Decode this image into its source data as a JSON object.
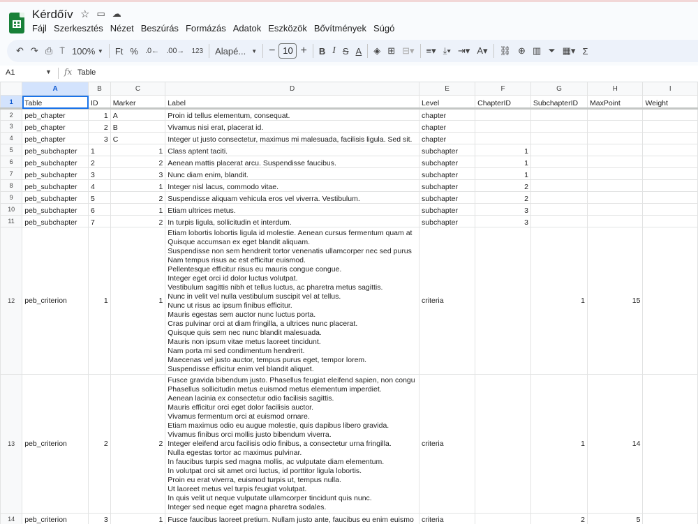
{
  "app": {
    "title": "Kérdőív"
  },
  "menu": [
    "Fájl",
    "Szerkesztés",
    "Nézet",
    "Beszúrás",
    "Formázás",
    "Adatok",
    "Eszközök",
    "Bővítmények",
    "Súgó"
  ],
  "toolbar": {
    "zoom": "100%",
    "currency": "Ft",
    "percent": "%",
    "dec_minus": ".0←",
    "dec_plus": ".00→",
    "number_format": "123",
    "font": "Alapé...",
    "font_size": "10"
  },
  "formula": {
    "cell": "A1",
    "fx": "fx",
    "value": "Table"
  },
  "columns": [
    "A",
    "B",
    "C",
    "D",
    "E",
    "F",
    "G",
    "H",
    "I"
  ],
  "rows": [
    {
      "n": "1",
      "cells": [
        "Table",
        "ID",
        "Marker",
        "Label",
        "Level",
        "ChapterID",
        "SubchapterID",
        "MaxPoint",
        "Weight"
      ]
    },
    {
      "n": "2",
      "cells": [
        "peb_chapter",
        "1",
        "A",
        "Proin id tellus elementum, consequat.",
        "chapter",
        "",
        "",
        "",
        ""
      ]
    },
    {
      "n": "3",
      "cells": [
        "peb_chapter",
        "2",
        "B",
        "Vivamus nisi erat, placerat id.",
        "chapter",
        "",
        "",
        "",
        ""
      ]
    },
    {
      "n": "4",
      "cells": [
        "peb_chapter",
        "3",
        "C",
        "Integer ut justo consectetur, maximus mi malesuada, facilisis ligula. Sed sit.",
        "chapter",
        "",
        "",
        "",
        ""
      ]
    },
    {
      "n": "5",
      "cells": [
        "peb_subchapter",
        "1",
        "1",
        "Class aptent taciti.",
        "subchapter",
        "1",
        "",
        "",
        ""
      ]
    },
    {
      "n": "6",
      "cells": [
        "peb_subchapter",
        "2",
        "2",
        "Aenean mattis placerat arcu. Suspendisse faucibus.",
        "subchapter",
        "1",
        "",
        "",
        ""
      ]
    },
    {
      "n": "7",
      "cells": [
        "peb_subchapter",
        "3",
        "3",
        "Nunc diam enim, blandit.",
        "subchapter",
        "1",
        "",
        "",
        ""
      ]
    },
    {
      "n": "8",
      "cells": [
        "peb_subchapter",
        "4",
        "1",
        "Integer nisl lacus, commodo vitae.",
        "subchapter",
        "2",
        "",
        "",
        ""
      ]
    },
    {
      "n": "9",
      "cells": [
        "peb_subchapter",
        "5",
        "2",
        "Suspendisse aliquam vehicula eros vel viverra. Vestibulum.",
        "subchapter",
        "2",
        "",
        "",
        ""
      ]
    },
    {
      "n": "10",
      "cells": [
        "peb_subchapter",
        "6",
        "1",
        "Etiam ultrices metus.",
        "subchapter",
        "3",
        "",
        "",
        ""
      ]
    },
    {
      "n": "11",
      "cells": [
        "peb_subchapter",
        "7",
        "2",
        "In turpis ligula, sollicitudin et interdum.",
        "subchapter",
        "3",
        "",
        "",
        ""
      ]
    },
    {
      "n": "12",
      "cells": [
        "peb_criterion",
        "1",
        "1",
        "Etiam lobortis lobortis ligula id molestie. Aenean cursus fermentum quam at\nQuisque accumsan ex eget blandit aliquam.\nSuspendisse non sem hendrerit tortor venenatis ullamcorper nec sed purus\nNam tempus risus ac est efficitur euismod.\nPellentesque efficitur risus eu mauris congue congue.\nInteger eget orci id dolor luctus volutpat.\nVestibulum sagittis nibh et tellus luctus, ac pharetra metus sagittis.\nNunc in velit vel nulla vestibulum suscipit vel at tellus.\nNunc ut risus ac ipsum finibus efficitur.\nMauris egestas sem auctor nunc luctus porta.\nCras pulvinar orci at diam fringilla, a ultrices nunc placerat.\nQuisque quis sem nec nunc blandit malesuada.\nMauris non ipsum vitae metus laoreet tincidunt.\nNam porta mi sed condimentum hendrerit.\nMaecenas vel justo auctor, tempus purus eget, tempor lorem.\nSuspendisse efficitur enim vel blandit aliquet.",
        "criteria",
        "",
        "1",
        "15",
        ""
      ]
    },
    {
      "n": "13",
      "cells": [
        "peb_criterion",
        "2",
        "2",
        "Fusce gravida bibendum justo. Phasellus feugiat eleifend sapien, non congu\nPhasellus sollicitudin metus euismod metus elementum imperdiet.\nAenean lacinia ex consectetur odio facilisis sagittis.\nMauris efficitur orci eget dolor facilisis auctor.\nVivamus fermentum orci at euismod ornare.\nEtiam maximus odio eu augue molestie, quis dapibus libero gravida.\nVivamus finibus orci mollis justo bibendum viverra.\nInteger eleifend arcu facilisis odio finibus, a consectetur urna fringilla.\nNulla egestas tortor ac maximus pulvinar.\nIn faucibus turpis sed magna mollis, ac vulputate diam elementum.\nIn volutpat orci sit amet orci luctus, id porttitor ligula lobortis.\nProin eu erat viverra, euismod turpis ut, tempus nulla.\nUt laoreet metus vel turpis feugiat volutpat.\nIn quis velit ut neque vulputate ullamcorper tincidunt quis nunc.\nInteger sed neque eget magna pharetra sodales.",
        "criteria",
        "",
        "1",
        "14",
        ""
      ]
    },
    {
      "n": "14",
      "cells": [
        "peb_criterion",
        "3",
        "1",
        "Fusce faucibus laoreet pretium. Nullam justo ante, faucibus eu enim euismo",
        "criteria",
        "",
        "2",
        "5",
        ""
      ]
    }
  ]
}
